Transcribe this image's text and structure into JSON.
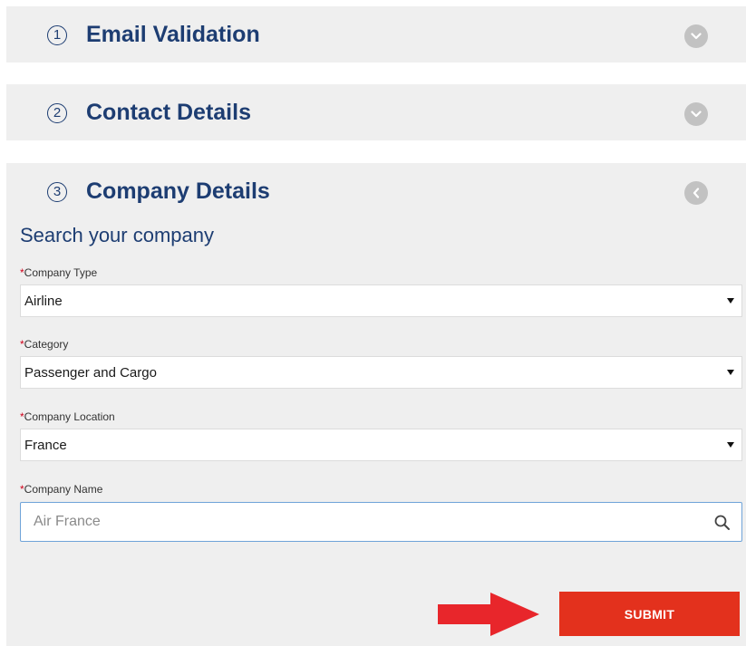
{
  "steps": [
    {
      "number": "1",
      "title": "Email Validation",
      "state": "collapsed"
    },
    {
      "number": "2",
      "title": "Contact Details",
      "state": "collapsed"
    },
    {
      "number": "3",
      "title": "Company Details",
      "state": "expanded"
    }
  ],
  "company_details": {
    "heading": "Search your company",
    "required_marker": "*",
    "company_type": {
      "label": "Company Type",
      "value": "Airline"
    },
    "category": {
      "label": "Category",
      "value": "Passenger and Cargo"
    },
    "company_location": {
      "label": "Company Location",
      "value": "France"
    },
    "company_name": {
      "label": "Company Name",
      "value": "",
      "placeholder": "Air France"
    },
    "submit_label": "SUBMIT"
  },
  "icons": {
    "toggle_collapsed": "chevron-down-icon",
    "toggle_expanded": "chevron-left-icon",
    "search": "search-icon",
    "pointer": "red-arrow-icon"
  },
  "colors": {
    "heading_blue": "#1d3d72",
    "panel_bg": "#efefef",
    "toggle_gray": "#c2c2c2",
    "required_red": "#d0021b",
    "submit_red": "#e3311d",
    "arrow_red": "#e8262b",
    "focus_border": "#6fa3d8"
  }
}
